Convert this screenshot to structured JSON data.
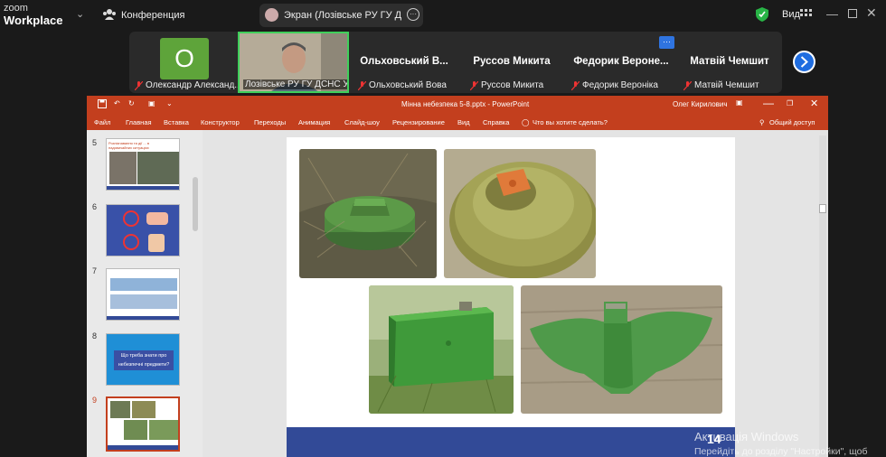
{
  "zoom": {
    "logo_line1": "zoom",
    "logo_line2": "Workplace",
    "conference_label": "Конференция",
    "screen_share_label": "Экран (Лозівське РУ ГУ ДСНС У",
    "view_label": "Вид",
    "participants": [
      {
        "initial": "O",
        "label": "Олександр Александ...",
        "muted": true
      },
      {
        "label": "Лозівське РУ ГУ ДСНС У...",
        "muted": false,
        "active": true
      },
      {
        "name": "Ольховський В...",
        "label": "Ольховський Вова",
        "muted": true
      },
      {
        "name": "Руссов Микита",
        "label": "Руссов Микита",
        "muted": true
      },
      {
        "name": "Федорик Вероне...",
        "label": "Федорик Вероніка",
        "muted": true
      },
      {
        "name": "Матвій Чемшит",
        "label": "Матвій Чемшит",
        "muted": true
      }
    ],
    "colors": {
      "active_border": "#3fcf5b",
      "accent_blue": "#1f6de0",
      "avatar_green": "#5ea43a"
    }
  },
  "powerpoint": {
    "window_title": "Мінна небезпека 5-8.pptx  -  PowerPoint",
    "user": "Олег Кирилович",
    "ribbon_tabs": [
      "Файл",
      "Главная",
      "Вставка",
      "Конструктор",
      "Переходы",
      "Анимация",
      "Слайд-шоу",
      "Рецензирование",
      "Вид",
      "Справка"
    ],
    "tell_me": "Что вы хотите сделать?",
    "share": "Общий доступ",
    "slide_thumbnails": [
      {
        "number": "5",
        "title": "Розпізнавання та дії ... в надзвичайних ситуаціях"
      },
      {
        "number": "6"
      },
      {
        "number": "7"
      },
      {
        "number": "8",
        "title": "Що треба знати про небезпечні предмети?"
      },
      {
        "number": "9",
        "selected": true
      }
    ],
    "current_slide_number": "14",
    "colors": {
      "ribbon": "#c33f1e",
      "slide_footer": "#324a97",
      "slide_bg": "#ffffff"
    }
  },
  "watermark": {
    "line1": "Активація Windows",
    "line2": "Перейдіть до розділу \"Настройки\", щоб"
  }
}
